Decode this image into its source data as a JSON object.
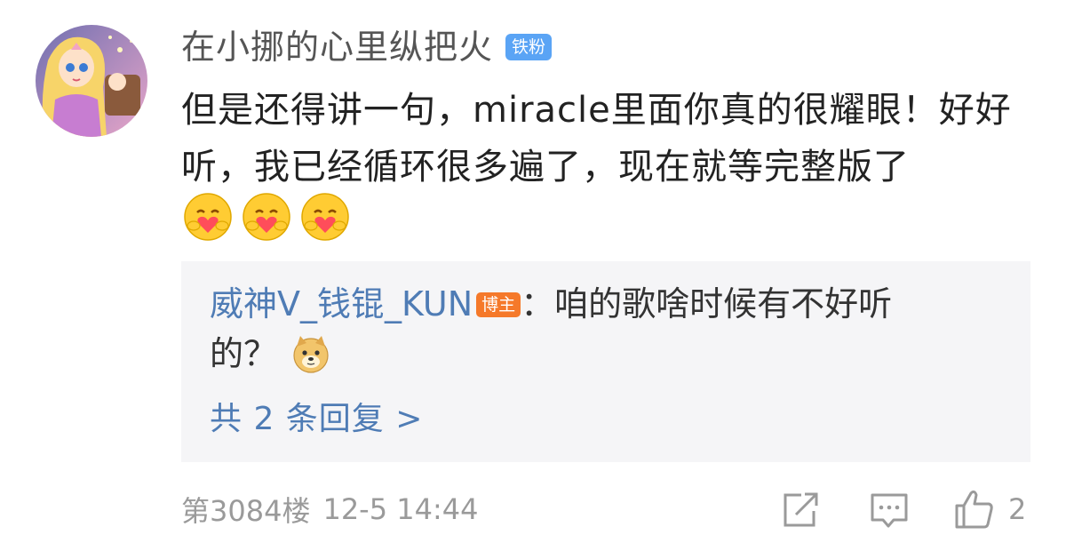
{
  "comment": {
    "username": "在小挪的心里纵把火",
    "fan_badge": "铁粉",
    "text": "但是还得讲一句，miracle里面你真的很耀眼！好好听，我已经循环很多遍了，现在就等完整版了",
    "emojis": [
      "hug-emoji",
      "hug-emoji",
      "hug-emoji"
    ],
    "avatar_icon": "cartoon-princess-avatar"
  },
  "reply": {
    "author": "威神V_钱锟_KUN",
    "host_badge": "博主",
    "separator": "：",
    "text_line1": "咱的歌啥时候有不好听",
    "text_line2": "的？",
    "emoji": "doge-emoji",
    "more_replies": "共 2 条回复 >"
  },
  "footer": {
    "floor": "第3084楼",
    "timestamp": "12-5 14:44",
    "like_count": "2",
    "icons": [
      "share-icon",
      "comment-icon",
      "like-icon"
    ]
  },
  "colors": {
    "link_blue": "#4f7cb5",
    "fan_badge": "#5aa4f5",
    "host_badge": "#f5792a",
    "reply_bg": "#f5f5f7",
    "meta_gray": "#9a9a9a"
  }
}
